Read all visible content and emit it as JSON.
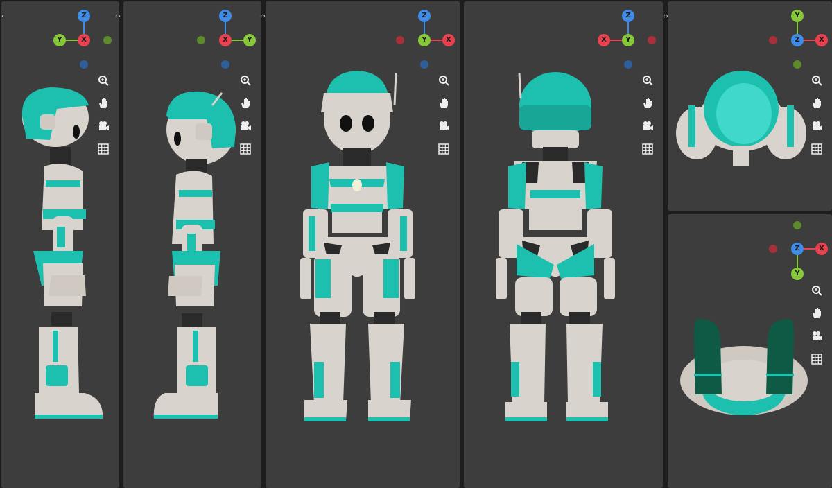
{
  "colors": {
    "x_axis": "#e8414f",
    "y_axis": "#86c83a",
    "z_axis": "#3f8ce8",
    "viewport_bg": "#3d3d3d",
    "gutter": "#1d1d1d",
    "robot_white": "#d8d3cc",
    "robot_teal": "#1dbfae"
  },
  "axis_labels": {
    "x": "X",
    "y": "Y",
    "z": "Z"
  },
  "navigation_tools": [
    "zoom-icon",
    "hand-pan-icon",
    "camera-icon",
    "grid-icon"
  ],
  "viewports": [
    {
      "id": "left",
      "view": "side-left"
    },
    {
      "id": "right",
      "view": "side-right"
    },
    {
      "id": "front",
      "view": "front"
    },
    {
      "id": "back",
      "view": "back"
    },
    {
      "id": "top",
      "view": "top"
    },
    {
      "id": "bottom",
      "view": "bottom"
    }
  ]
}
